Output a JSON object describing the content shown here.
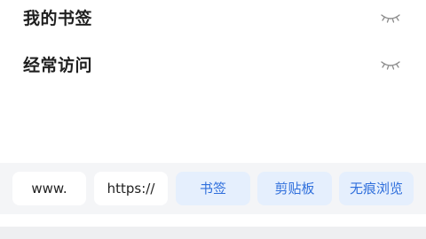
{
  "menu": {
    "items": [
      {
        "label": "我的书签",
        "icon": "closed-eye-icon"
      },
      {
        "label": "经常访问",
        "icon": "closed-eye-icon"
      }
    ]
  },
  "quick_input_bar": {
    "chips": [
      {
        "label": "www."
      },
      {
        "label": "https://"
      },
      {
        "label": "书签"
      },
      {
        "label": "剪贴板"
      },
      {
        "label": "无痕浏览"
      }
    ]
  },
  "colors": {
    "accent": "#2f6fdc",
    "accent_bg": "#e5effd",
    "bar_bg": "#f4f5f7",
    "text": "#1f1f1f"
  }
}
